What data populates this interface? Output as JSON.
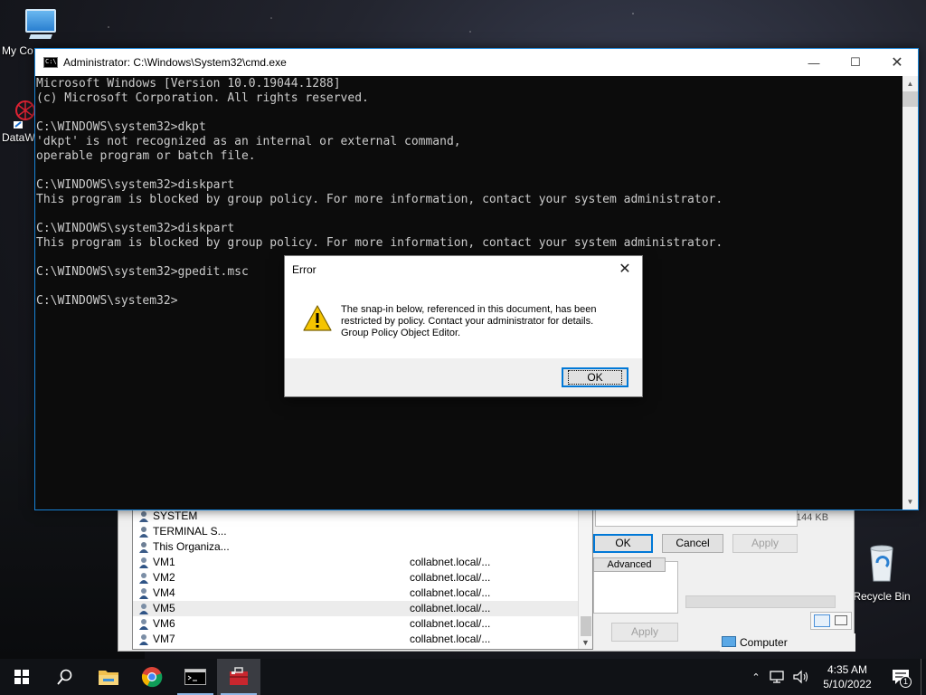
{
  "desktop": {
    "icons": [
      {
        "label": "My Co",
        "icon": "computer-icon"
      },
      {
        "label": "DataW",
        "icon": "datawarehouse-icon"
      },
      {
        "label": "Recycle Bin",
        "icon": "recycle-bin-icon"
      }
    ]
  },
  "background_window": {
    "list_rows": [
      {
        "name": "SYSTEM",
        "domain": ""
      },
      {
        "name": "TERMINAL S...",
        "domain": ""
      },
      {
        "name": "This Organiza...",
        "domain": ""
      },
      {
        "name": "VM1",
        "domain": "collabnet.local/..."
      },
      {
        "name": "VM2",
        "domain": "collabnet.local/..."
      },
      {
        "name": "VM4",
        "domain": "collabnet.local/..."
      },
      {
        "name": "VM5",
        "domain": "collabnet.local/..."
      },
      {
        "name": "VM6",
        "domain": "collabnet.local/..."
      },
      {
        "name": "VM7",
        "domain": "collabnet.local/..."
      }
    ],
    "size_text": "144 KB",
    "ok_label": "OK",
    "cancel_label": "Cancel",
    "apply_label": "Apply",
    "advanced_label": "Advanced",
    "apply2_label": "Apply",
    "computer_label": "Computer"
  },
  "cmd": {
    "title": "Administrator: C:\\Windows\\System32\\cmd.exe",
    "lines": [
      "Microsoft Windows [Version 10.0.19044.1288]",
      "(c) Microsoft Corporation. All rights reserved.",
      "",
      "C:\\WINDOWS\\system32>dkpt",
      "'dkpt' is not recognized as an internal or external command,",
      "operable program or batch file.",
      "",
      "C:\\WINDOWS\\system32>diskpart",
      "This program is blocked by group policy. For more information, contact your system administrator.",
      "",
      "C:\\WINDOWS\\system32>diskpart",
      "This program is blocked by group policy. For more information, contact your system administrator.",
      "",
      "C:\\WINDOWS\\system32>gpedit.msc",
      "",
      "C:\\WINDOWS\\system32>"
    ]
  },
  "dialog": {
    "title": "Error",
    "message_lines": [
      "The snap-in below, referenced in this document, has been",
      "restricted by policy. Contact your administrator for details.",
      "Group Policy Object Editor."
    ],
    "ok_label": "OK"
  },
  "taskbar": {
    "time": "4:35 AM",
    "date": "5/10/2022",
    "notification_count": "1"
  }
}
